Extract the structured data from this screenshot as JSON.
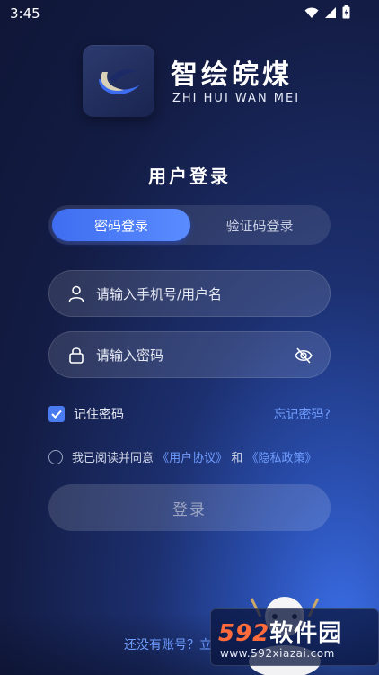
{
  "status_bar": {
    "time": "3:45"
  },
  "brand": {
    "name": "智绘皖煤",
    "subtitle": "ZHI HUI WAN MEI"
  },
  "login": {
    "title": "用户登录",
    "tabs": [
      {
        "label": "密码登录",
        "active": true
      },
      {
        "label": "验证码登录",
        "active": false
      }
    ],
    "username": {
      "placeholder": "请输入手机号/用户名",
      "value": ""
    },
    "password": {
      "placeholder": "请输入密码",
      "value": ""
    },
    "remember_label": "记住密码",
    "remember_checked": true,
    "forgot_label": "忘记密码?",
    "agreement": {
      "prefix": "我已阅读并同意",
      "user_agreement": "《用户协议》",
      "and": "和",
      "privacy_policy": "《隐私政策》",
      "checked": false
    },
    "submit_label": "登录",
    "register_prompt": "还没有账号？立"
  },
  "watermark": {
    "number": "592",
    "text": "软件园",
    "url": "www.592xiazai.com"
  },
  "colors": {
    "accent": "#4a7bf0",
    "link": "#6f9dff",
    "watermark_number": "#ff6b3a"
  }
}
